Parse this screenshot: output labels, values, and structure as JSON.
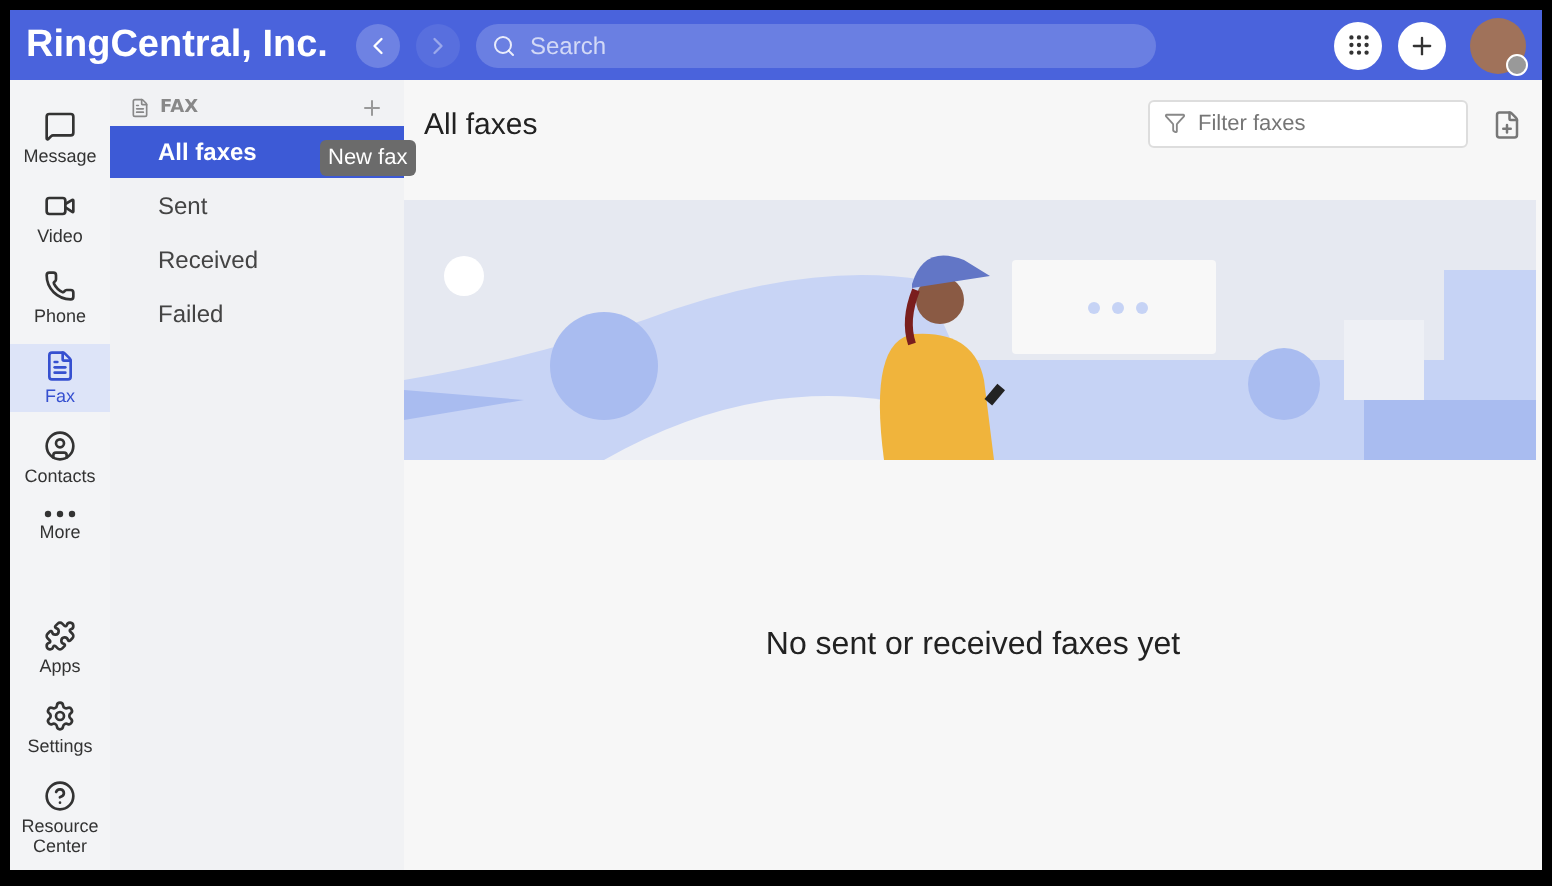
{
  "header": {
    "title": "RingCentral, Inc.",
    "search": {
      "placeholder": "Search"
    }
  },
  "rail": {
    "top": [
      {
        "label": "Message",
        "selected": false
      },
      {
        "label": "Video",
        "selected": false
      },
      {
        "label": "Phone",
        "selected": false
      },
      {
        "label": "Fax",
        "selected": true
      },
      {
        "label": "Contacts",
        "selected": false
      },
      {
        "label": "More",
        "selected": false
      }
    ],
    "bottom": [
      {
        "label": "Apps",
        "selected": false
      },
      {
        "label": "Settings",
        "selected": false
      },
      {
        "label": "Resource Center",
        "selected": false
      }
    ]
  },
  "fax_panel": {
    "heading": "FAX",
    "tooltip": "New fax",
    "items": [
      {
        "label": "All faxes",
        "selected": true
      },
      {
        "label": "Sent",
        "selected": false
      },
      {
        "label": "Received",
        "selected": false
      },
      {
        "label": "Failed",
        "selected": false
      }
    ]
  },
  "main": {
    "title": "All faxes",
    "filter": {
      "placeholder": "Filter faxes"
    },
    "empty_message": "No sent or received faxes yet"
  }
}
